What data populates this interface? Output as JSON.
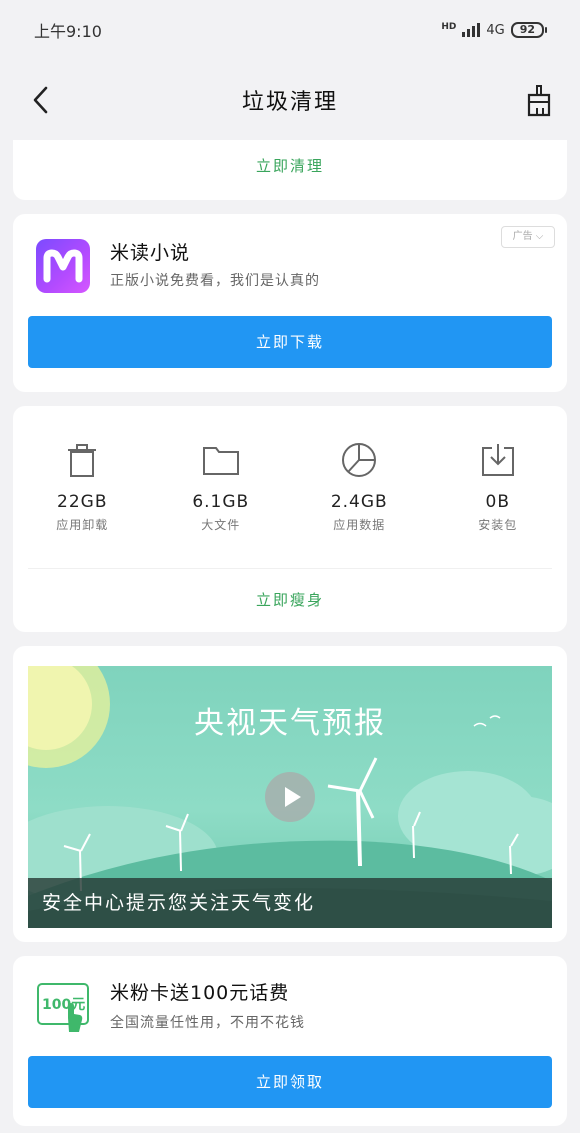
{
  "status": {
    "time": "上午9:10",
    "network": "4G",
    "hd": "HD",
    "battery": "92"
  },
  "header": {
    "title": "垃圾清理"
  },
  "top_card": {
    "action": "立即清理"
  },
  "ad_card": {
    "app_name": "米读小说",
    "description": "正版小说免费看，我们是认真的",
    "ad_tag": "广告",
    "button": "立即下载"
  },
  "storage": {
    "items": [
      {
        "value": "22GB",
        "label": "应用卸载",
        "icon": "trash-icon"
      },
      {
        "value": "6.1GB",
        "label": "大文件",
        "icon": "folder-icon"
      },
      {
        "value": "2.4GB",
        "label": "应用数据",
        "icon": "pie-icon"
      },
      {
        "value": "0B",
        "label": "安装包",
        "icon": "download-box-icon"
      }
    ],
    "action": "立即瘦身"
  },
  "video_card": {
    "title": "央视天气预报",
    "caption": "安全中心提示您关注天气变化"
  },
  "promo_card": {
    "badge": "100元",
    "title": "米粉卡送100元话费",
    "description": "全国流量任性用，不用不花钱",
    "button": "立即领取"
  },
  "colors": {
    "accent_blue": "#2196f3",
    "link_green": "#3aa55c"
  }
}
